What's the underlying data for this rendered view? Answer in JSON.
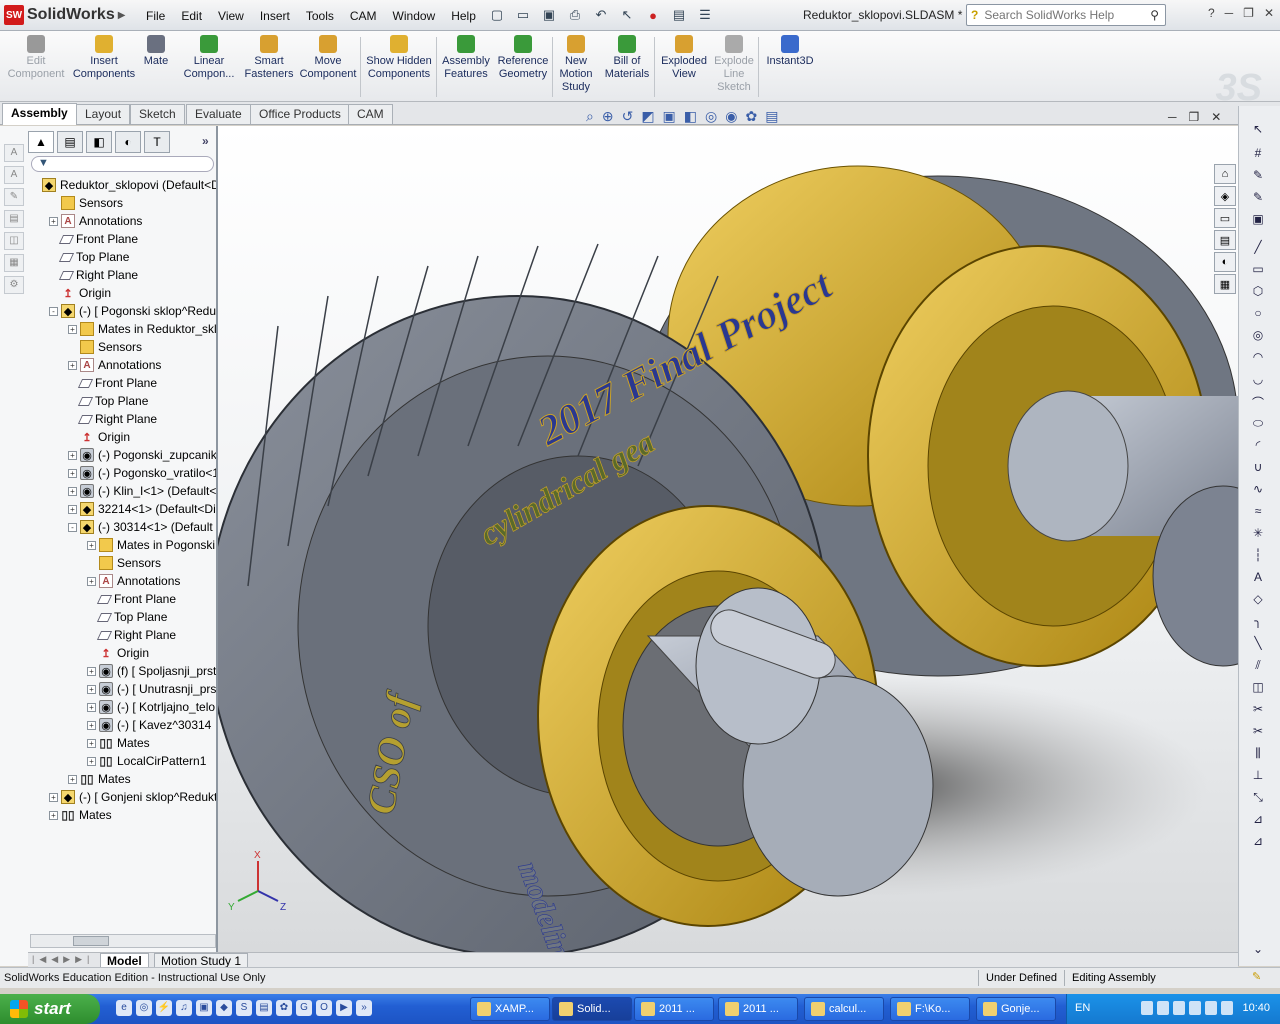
{
  "app": {
    "brand": "SolidWorks",
    "logo_text": "SW",
    "doc_title": "Reduktor_sklopovi.SLDASM *"
  },
  "menus": [
    "File",
    "Edit",
    "View",
    "Insert",
    "Tools",
    "CAM",
    "Window",
    "Help"
  ],
  "search": {
    "placeholder": "Search SolidWorks Help"
  },
  "commands": [
    {
      "label": "Edit Component",
      "enabled": false
    },
    {
      "label": "Insert Components",
      "enabled": true
    },
    {
      "label": "Mate",
      "enabled": true
    },
    {
      "label": "Linear Compon...",
      "enabled": true
    },
    {
      "label": "Smart Fasteners",
      "enabled": true
    },
    {
      "label": "Move Component",
      "enabled": true
    },
    {
      "label": "Show Hidden Components",
      "enabled": true
    },
    {
      "label": "Assembly Features",
      "enabled": true
    },
    {
      "label": "Reference Geometry",
      "enabled": true
    },
    {
      "label": "New Motion Study",
      "enabled": true
    },
    {
      "label": "Bill of Materials",
      "enabled": true
    },
    {
      "label": "Exploded View",
      "enabled": true
    },
    {
      "label": "Explode Line Sketch",
      "enabled": false
    },
    {
      "label": "Instant3D",
      "enabled": true
    }
  ],
  "tabs": [
    "Assembly",
    "Layout",
    "Sketch",
    "Evaluate",
    "Office Products",
    "CAM"
  ],
  "active_tab": "Assembly",
  "tree": [
    {
      "label": "Reduktor_sklopovi  (Default<D",
      "depth": 0,
      "icon": "asm",
      "pm": ""
    },
    {
      "label": "Sensors",
      "depth": 1,
      "icon": "folder",
      "pm": ""
    },
    {
      "label": "Annotations",
      "depth": 1,
      "icon": "ann",
      "pm": "+"
    },
    {
      "label": "Front Plane",
      "depth": 1,
      "icon": "plane",
      "pm": ""
    },
    {
      "label": "Top Plane",
      "depth": 1,
      "icon": "plane",
      "pm": ""
    },
    {
      "label": "Right Plane",
      "depth": 1,
      "icon": "plane",
      "pm": ""
    },
    {
      "label": "Origin",
      "depth": 1,
      "icon": "origin",
      "pm": ""
    },
    {
      "label": "(-) [ Pogonski sklop^Reduk",
      "depth": 1,
      "icon": "asm",
      "pm": "-"
    },
    {
      "label": "Mates in Reduktor_sklopov",
      "depth": 2,
      "icon": "folder",
      "pm": "+"
    },
    {
      "label": "Sensors",
      "depth": 2,
      "icon": "folder",
      "pm": ""
    },
    {
      "label": "Annotations",
      "depth": 2,
      "icon": "ann",
      "pm": "+"
    },
    {
      "label": "Front Plane",
      "depth": 2,
      "icon": "plane",
      "pm": ""
    },
    {
      "label": "Top Plane",
      "depth": 2,
      "icon": "plane",
      "pm": ""
    },
    {
      "label": "Right Plane",
      "depth": 2,
      "icon": "plane",
      "pm": ""
    },
    {
      "label": "Origin",
      "depth": 2,
      "icon": "origin",
      "pm": ""
    },
    {
      "label": "(-) Pogonski_zupcanik<",
      "depth": 2,
      "icon": "part",
      "pm": "+"
    },
    {
      "label": "(-) Pogonsko_vratilo<1",
      "depth": 2,
      "icon": "part",
      "pm": "+"
    },
    {
      "label": "(-) Klin_I<1> (Default<",
      "depth": 2,
      "icon": "part",
      "pm": "+"
    },
    {
      "label": "32214<1> (Default<Displ",
      "depth": 2,
      "icon": "asm",
      "pm": "+"
    },
    {
      "label": "(-) 30314<1> (Default",
      "depth": 2,
      "icon": "asm",
      "pm": "-"
    },
    {
      "label": "Mates in Pogonski sklo",
      "depth": 3,
      "icon": "folder",
      "pm": "+"
    },
    {
      "label": "Sensors",
      "depth": 3,
      "icon": "folder",
      "pm": ""
    },
    {
      "label": "Annotations",
      "depth": 3,
      "icon": "ann",
      "pm": "+"
    },
    {
      "label": "Front Plane",
      "depth": 3,
      "icon": "plane",
      "pm": ""
    },
    {
      "label": "Top Plane",
      "depth": 3,
      "icon": "plane",
      "pm": ""
    },
    {
      "label": "Right Plane",
      "depth": 3,
      "icon": "plane",
      "pm": ""
    },
    {
      "label": "Origin",
      "depth": 3,
      "icon": "origin",
      "pm": ""
    },
    {
      "label": "(f) [ Spoljasnji_prst",
      "depth": 3,
      "icon": "part",
      "pm": "+"
    },
    {
      "label": "(-) [ Unutrasnji_prs",
      "depth": 3,
      "icon": "part",
      "pm": "+"
    },
    {
      "label": "(-) [ Kotrljajno_telo",
      "depth": 3,
      "icon": "part",
      "pm": "+"
    },
    {
      "label": "(-) [ Kavez^30314",
      "depth": 3,
      "icon": "part",
      "pm": "+"
    },
    {
      "label": "Mates",
      "depth": 3,
      "icon": "mates",
      "pm": "+"
    },
    {
      "label": "LocalCirPattern1",
      "depth": 3,
      "icon": "mates",
      "pm": "+"
    },
    {
      "label": "Mates",
      "depth": 2,
      "icon": "mates",
      "pm": "+"
    },
    {
      "label": "(-) [ Gonjeni sklop^Reduktor_s",
      "depth": 1,
      "icon": "asm",
      "pm": "+"
    },
    {
      "label": "Mates",
      "depth": 1,
      "icon": "mates",
      "pm": "+"
    }
  ],
  "model_text": {
    "line1": "2017 Final Project",
    "line2": "cylindrical gea",
    "line3": "CSO of",
    "line4": "modeling and"
  },
  "bottom_tabs": [
    "Model",
    "Motion Study 1"
  ],
  "status": {
    "edition": "SolidWorks Education Edition - Instructional Use Only",
    "state": "Under Defined",
    "mode": "Editing Assembly"
  },
  "taskbar": {
    "start_label": "start",
    "tasks": [
      "XAMP...",
      "Solid...",
      "2011 ...",
      "2011 ...",
      "calcul...",
      "F:\\Ko...",
      "Gonje..."
    ],
    "language": "EN",
    "clock": "10:40"
  },
  "colors": {
    "gear": "#6e7480",
    "bearing": "#c9a227",
    "shaft": "#8e96a4",
    "accent": "#d21b1b"
  }
}
